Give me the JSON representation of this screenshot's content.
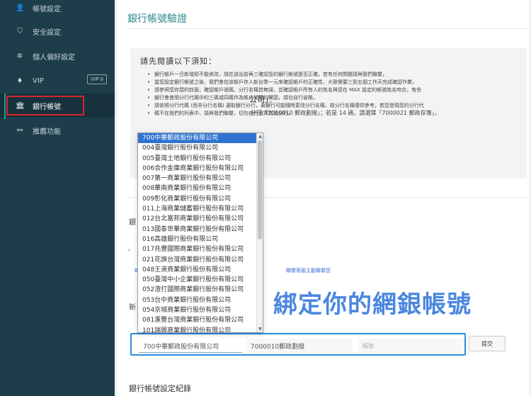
{
  "sidebar": {
    "items": [
      {
        "name": "account-settings",
        "icon": "user-icon",
        "glyph": "👤",
        "label": "帳號設定"
      },
      {
        "name": "security-settings",
        "icon": "shield-icon",
        "glyph": "⛉",
        "label": "安全設定"
      },
      {
        "name": "preferences",
        "icon": "gear-icon",
        "glyph": "✲",
        "label": "個人偏好設定"
      },
      {
        "name": "vip",
        "icon": "diamond-icon",
        "glyph": "♦",
        "label": "VIP",
        "badge": "VIP 0"
      },
      {
        "name": "bank-account",
        "icon": "bank-icon",
        "glyph": "🏛",
        "label": "銀行帳號"
      },
      {
        "name": "referral",
        "icon": "link-icon",
        "glyph": "⚯",
        "label": "推薦功能"
      }
    ]
  },
  "main": {
    "title": "銀行帳號驗證",
    "notice_heading": "請先閱讀以下須知：",
    "notices": [
      "銀行帳戶一旦新增即不能修改，請在送出前再三確認您的銀行帳號是否正確，若有任何問題請與我們聯繫，",
      "當您設定銀行帳號之後，我們會在該帳戶存入新台幣一元來確認帳戶的正確性，大致需要三到五個工作天完成確認作業，",
      "請參照您存摺的封面，確認帳戶號碼、分行名稱皆無誤，並確認帳戶所有人的姓名與您在 MAX 設定的帳號姓名吻合，有些",
      "銀行會使用分行代碼中的三碼或四碼作為帳戶號碼的開頭，請勿自行省略，",
      "請依照分行代碼 (而非分行名稱) 選取銀行分行，貴銀行可能隨時更改分行名稱，故分行名稱僅供參考，若您發現您的分行代",
      "碼不在我們的列表中，請與我們聯繫，切勿自行選擇其他分行，"
    ],
    "bank_question": "公司」：",
    "bank_example": "分行「7000010 郵政劃撥」；若是 14 碼，請選擇「7000021 郵政存簿」，",
    "frag_1": "銀",
    "frag_2": ")",
    "frag_3": "，",
    "frag_4": "B",
    "frag_5": "聯繫客服主動聯繫您",
    "frag_6": "新",
    "watermark": "綁定你的網銀帳號",
    "form": {
      "bank_selected": "700中華郵政股份有限公司",
      "branch_value": "7000010郵政劃撥",
      "account_placeholder": "帳號",
      "submit_label": "提交"
    },
    "history_title": "銀行帳號設定紀錄"
  },
  "dropdown": {
    "selected": "700中華郵政股份有限公司",
    "options": [
      "004臺灣銀行股份有限公司",
      "005臺灣土地銀行股份有限公司",
      "006合作金庫商業銀行股份有限公司",
      "007第一商業銀行股份有限公司",
      "008華南商業銀行股份有限公司",
      "009彰化商業銀行股份有限公司",
      "011上海商業儲蓄銀行股份有限公司",
      "012台北富邦商業銀行股份有限公司",
      "013國泰世華商業銀行股份有限公司",
      "016高雄銀行股份有限公司",
      "017兆豐國際商業銀行股份有限公司",
      "021花旗台灣商業銀行股份有限公司",
      "048王道商業銀行股份有限公司",
      "050臺灣中小企業銀行股份有限公司",
      "052渣打國際商業銀行股份有限公司",
      "053台中商業銀行股份有限公司",
      "054京城商業銀行股份有限公司",
      "081滙豐台灣商業銀行股份有限公司",
      "101瑞興商業銀行股份有限公司"
    ],
    "scroll_up": "▲",
    "scroll_down": "▼"
  },
  "colors": {
    "sidebar_bg": "#1d3d4a",
    "accent_teal": "#2f8a8a",
    "highlight_red": "#d8262b",
    "highlight_blue": "#2a8de0",
    "watermark_blue": "#4a86df",
    "dropdown_selected": "#2f73d1"
  }
}
